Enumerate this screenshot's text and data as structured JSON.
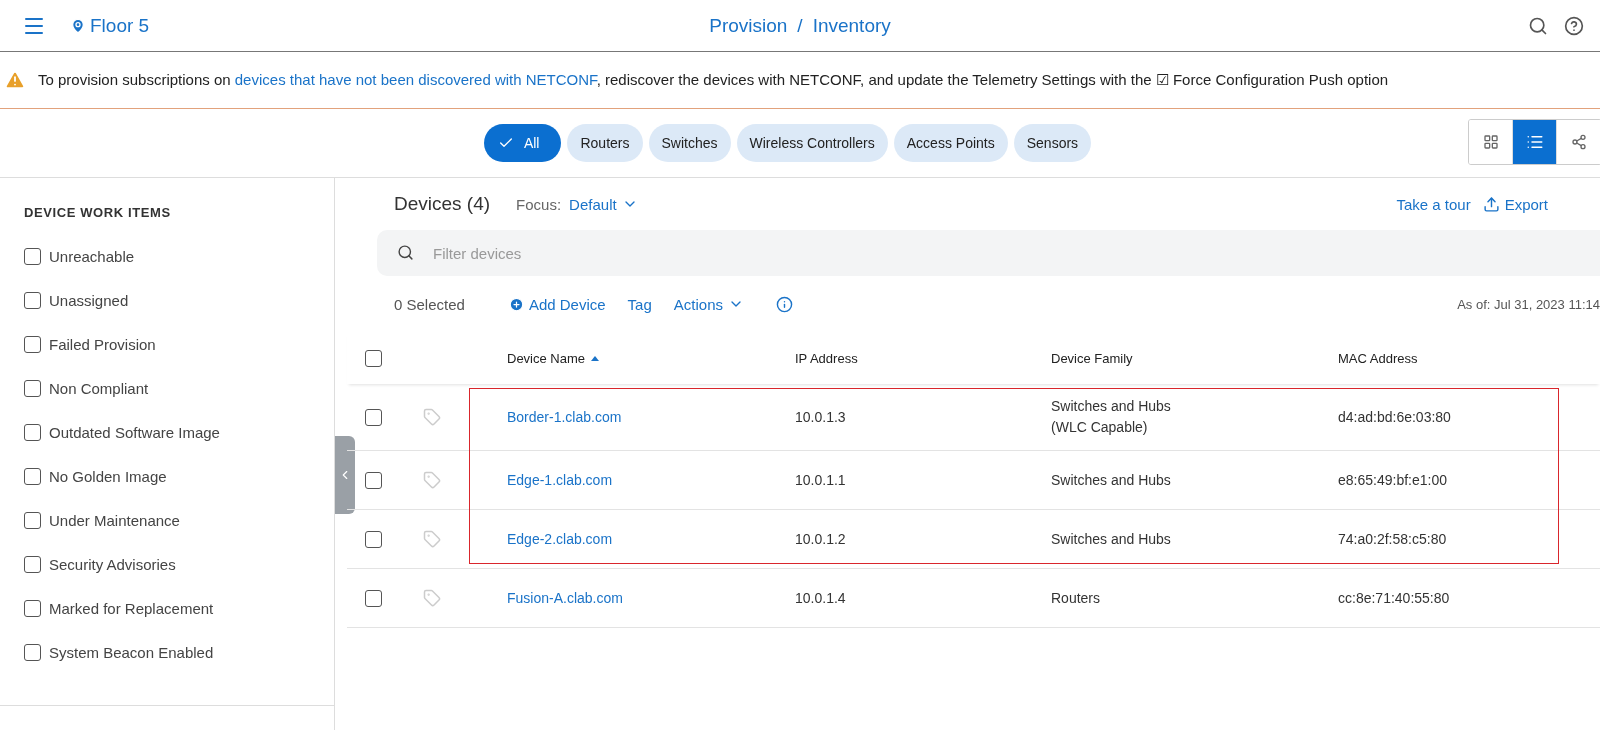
{
  "header": {
    "location": "Floor 5",
    "breadcrumb": [
      "Provision",
      "Inventory"
    ],
    "separator": "/"
  },
  "banner": {
    "text_before": "To provision subscriptions on ",
    "link": "devices that have not been discovered with NETCONF",
    "text_after": ", rediscover the devices with NETCONF, and update the Telemetry Settings with the ☑ Force Configuration Push option"
  },
  "filters": [
    {
      "label": "All",
      "selected": true
    },
    {
      "label": "Routers",
      "selected": false
    },
    {
      "label": "Switches",
      "selected": false
    },
    {
      "label": "Wireless Controllers",
      "selected": false
    },
    {
      "label": "Access Points",
      "selected": false
    },
    {
      "label": "Sensors",
      "selected": false
    }
  ],
  "views": [
    {
      "kind": "grid",
      "selected": false
    },
    {
      "kind": "list",
      "selected": true
    },
    {
      "kind": "topology",
      "selected": false
    }
  ],
  "sidebar": {
    "title": "DEVICE WORK ITEMS",
    "items": [
      {
        "label": "Unreachable",
        "checked": false
      },
      {
        "label": "Unassigned",
        "checked": false
      },
      {
        "label": "Failed Provision",
        "checked": false
      },
      {
        "label": "Non Compliant",
        "checked": false
      },
      {
        "label": "Outdated Software Image",
        "checked": false
      },
      {
        "label": "No Golden Image",
        "checked": false
      },
      {
        "label": "Under Maintenance",
        "checked": false
      },
      {
        "label": "Security Advisories",
        "checked": false
      },
      {
        "label": "Marked for Replacement",
        "checked": false
      },
      {
        "label": "System Beacon Enabled",
        "checked": false
      }
    ]
  },
  "devices": {
    "title": "Devices",
    "count": "(4)",
    "focus_label": "Focus:",
    "focus_value": "Default",
    "tour": "Take a tour",
    "export": "Export",
    "filter_placeholder": "Filter devices",
    "selected_count": "0 Selected",
    "add_device": "Add Device",
    "tag": "Tag",
    "actions": "Actions",
    "as_of": "As of: Jul 31, 2023 11:14"
  },
  "table": {
    "all_checked": false,
    "columns": [
      "Device Name",
      "IP Address",
      "Device Family",
      "MAC Address"
    ],
    "rows": [
      {
        "name": "Border-1.clab.com",
        "ip": "10.0.1.3",
        "family": [
          "Switches and Hubs",
          "(WLC Capable)"
        ],
        "mac": "d4:ad:bd:6e:03:80",
        "checked": false,
        "highlighted": true
      },
      {
        "name": "Edge-1.clab.com",
        "ip": "10.0.1.1",
        "family": [
          "Switches and Hubs"
        ],
        "mac": "e8:65:49:bf:e1:00",
        "checked": false,
        "highlighted": true
      },
      {
        "name": "Edge-2.clab.com",
        "ip": "10.0.1.2",
        "family": [
          "Switches and Hubs"
        ],
        "mac": "74:a0:2f:58:c5:80",
        "checked": false,
        "highlighted": true
      },
      {
        "name": "Fusion-A.clab.com",
        "ip": "10.0.1.4",
        "family": [
          "Routers"
        ],
        "mac": "cc:8e:71:40:55:80",
        "checked": false,
        "highlighted": false
      }
    ]
  }
}
